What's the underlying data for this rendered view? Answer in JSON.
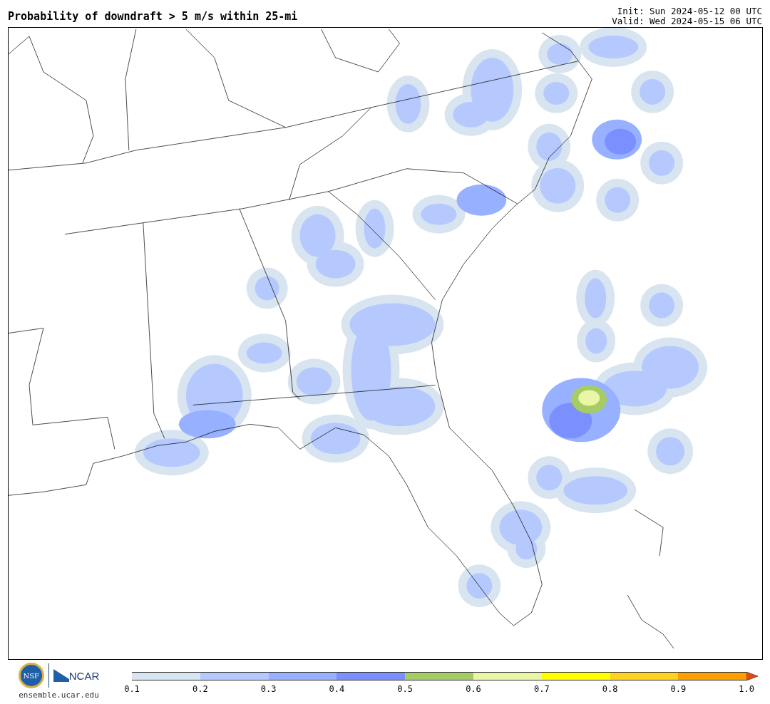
{
  "title": "Probability of downdraft > 5 m/s within 25-mi",
  "init": "Init: Sun 2024-05-12 00 UTC",
  "valid": "Valid: Wed 2024-05-15 06 UTC",
  "logos": {
    "seal": "NSF",
    "wordmark": "NCAR",
    "site": "ensemble.ucar.edu"
  },
  "colorbar": {
    "bins": [
      {
        "color": "#d8e4ef"
      },
      {
        "color": "#b5c9ff"
      },
      {
        "color": "#97b0ff"
      },
      {
        "color": "#7b8fff"
      },
      {
        "color": "#a6cc66"
      },
      {
        "color": "#eaf5a6"
      },
      {
        "color": "#ffff00"
      },
      {
        "color": "#ffd21f"
      },
      {
        "color": "#ff9f00"
      }
    ],
    "overflow": {
      "color": "#e84a0c"
    },
    "ticks": [
      "0.1",
      "0.2",
      "0.3",
      "0.4",
      "0.5",
      "0.6",
      "0.7",
      "0.8",
      "0.9",
      "1.0"
    ]
  }
}
